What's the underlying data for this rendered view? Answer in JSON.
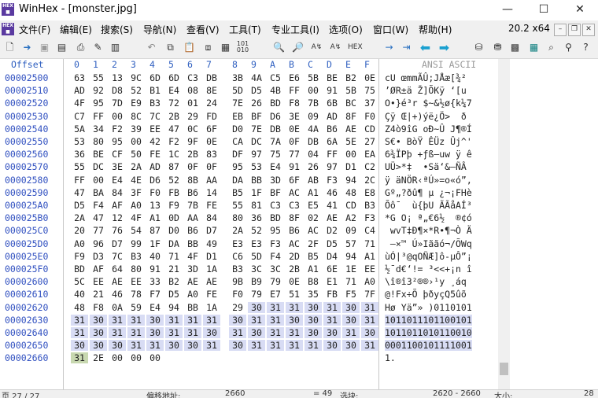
{
  "window": {
    "title": "WinHex - [monster.jpg]",
    "minimize": "—",
    "maximize": "☐",
    "close": "✕"
  },
  "menu": [
    "文件(F)",
    "编辑(E)",
    "搜索(S)",
    "导航(N)",
    "查看(V)",
    "工具(T)",
    "专业工具(I)",
    "选项(O)",
    "窗口(W)",
    "帮助(H)"
  ],
  "version": "20.2 x64",
  "header": {
    "offset_label": "Offset",
    "columns": [
      "0",
      "1",
      "2",
      "3",
      "4",
      "5",
      "6",
      "7",
      "8",
      "9",
      "A",
      "B",
      "C",
      "D",
      "E",
      "F"
    ],
    "ansi_label": "ANSI ASCII"
  },
  "rows": [
    {
      "offset": "00002500",
      "bytes": [
        "63",
        "55",
        "13",
        "9C",
        "6D",
        "6D",
        "C3",
        "DB",
        "3B",
        "4A",
        "C5",
        "E6",
        "5B",
        "BE",
        "B2",
        "0E"
      ],
      "ansi": "cU œmmÃÛ;JÅæ[¾²"
    },
    {
      "offset": "00002510",
      "bytes": [
        "AD",
        "92",
        "D8",
        "52",
        "B1",
        "E4",
        "08",
        "8E",
        "5D",
        "D5",
        "4B",
        "FF",
        "00",
        "91",
        "5B",
        "75"
      ],
      "ansi": "­’ØR±ä Ž]ÕKÿ ‘[u"
    },
    {
      "offset": "00002520",
      "bytes": [
        "4F",
        "95",
        "7D",
        "E9",
        "B3",
        "72",
        "01",
        "24",
        "7E",
        "26",
        "BD",
        "F8",
        "7B",
        "6B",
        "BC",
        "37"
      ],
      "ansi": "O•}é³r $~&½ø{k¼7"
    },
    {
      "offset": "00002530",
      "bytes": [
        "C7",
        "FF",
        "00",
        "8C",
        "7C",
        "2B",
        "29",
        "FD",
        "EB",
        "BF",
        "D6",
        "3E",
        "09",
        "AD",
        "8F",
        "F0"
      ],
      "ansi": "Çÿ Œ|+)ýë¿Ö> ­ ð"
    },
    {
      "offset": "00002540",
      "bytes": [
        "5A",
        "34",
        "F2",
        "39",
        "EE",
        "47",
        "0C",
        "6F",
        "D0",
        "7E",
        "DB",
        "0E",
        "4A",
        "B6",
        "AE",
        "CD"
      ],
      "ansi": "Z4ò9îG oÐ~Û J¶®Í"
    },
    {
      "offset": "00002550",
      "bytes": [
        "53",
        "80",
        "95",
        "00",
        "42",
        "F2",
        "9F",
        "0E",
        "CA",
        "DC",
        "7A",
        "0F",
        "DB",
        "6A",
        "5E",
        "27"
      ],
      "ansi": "S€• BòŸ ÊÜz Ûj^'"
    },
    {
      "offset": "00002560",
      "bytes": [
        "36",
        "BE",
        "CF",
        "50",
        "FE",
        "1C",
        "2B",
        "83",
        "DF",
        "97",
        "75",
        "77",
        "04",
        "FF",
        "00",
        "EA"
      ],
      "ansi": "6¾ÏPþ +ƒß—uw ÿ ê"
    },
    {
      "offset": "00002570",
      "bytes": [
        "55",
        "DC",
        "3E",
        "2A",
        "AD",
        "87",
        "0F",
        "0F",
        "95",
        "53",
        "E4",
        "91",
        "26",
        "97",
        "D1",
        "C2"
      ],
      "ansi": "UÜ>*­‡  •Sä‘&—ÑÂ"
    },
    {
      "offset": "00002580",
      "bytes": [
        "FF",
        "00",
        "E4",
        "4E",
        "D6",
        "52",
        "8B",
        "AA",
        "DA",
        "BB",
        "3D",
        "6F",
        "AB",
        "F3",
        "94",
        "2C"
      ],
      "ansi": "ÿ äNÖR‹ªÚ»=o«ó”,"
    },
    {
      "offset": "00002590",
      "bytes": [
        "47",
        "BA",
        "84",
        "3F",
        "F0",
        "FB",
        "B6",
        "14",
        "B5",
        "1F",
        "BF",
        "AC",
        "A1",
        "46",
        "48",
        "E8"
      ],
      "ansi": "Gº„?ðû¶ µ ¿¬¡FHè"
    },
    {
      "offset": "000025A0",
      "bytes": [
        "D5",
        "F4",
        "AF",
        "A0",
        "13",
        "F9",
        "7B",
        "FE",
        "55",
        "81",
        "C3",
        "C3",
        "E5",
        "41",
        "CD",
        "B3"
      ],
      "ansi": "Õô¯  ù{þU ÃÃåAÍ³"
    },
    {
      "offset": "000025B0",
      "bytes": [
        "2A",
        "47",
        "12",
        "4F",
        "A1",
        "0D",
        "AA",
        "84",
        "80",
        "36",
        "BD",
        "8F",
        "02",
        "AE",
        "A2",
        "F3"
      ],
      "ansi": "*G O¡ ª„€6½  ®¢ó"
    },
    {
      "offset": "000025C0",
      "bytes": [
        "20",
        "77",
        "76",
        "54",
        "87",
        "D0",
        "B6",
        "D7",
        "2A",
        "52",
        "95",
        "B6",
        "AC",
        "D2",
        "09",
        "C4"
      ],
      "ansi": " wvT‡Ð¶×*R•¶¬Ò Ä"
    },
    {
      "offset": "000025D0",
      "bytes": [
        "A0",
        "96",
        "D7",
        "99",
        "1F",
        "DA",
        "BB",
        "49",
        "E3",
        "E3",
        "F3",
        "AC",
        "2F",
        "D5",
        "57",
        "71"
      ],
      "ansi": " –×™ Ú»Iããó¬/ÕWq"
    },
    {
      "offset": "000025E0",
      "bytes": [
        "F9",
        "D3",
        "7C",
        "B3",
        "40",
        "71",
        "4F",
        "D1",
        "C6",
        "5D",
        "F4",
        "2D",
        "B5",
        "D4",
        "94",
        "A1"
      ],
      "ansi": "ùÓ|³@qOÑÆ]ô-µÔ”¡"
    },
    {
      "offset": "000025F0",
      "bytes": [
        "BD",
        "AF",
        "64",
        "80",
        "91",
        "21",
        "3D",
        "1A",
        "B3",
        "3C",
        "3C",
        "2B",
        "A1",
        "6E",
        "1E",
        "EE"
      ],
      "ansi": "½¯d€‘!= ³<<+¡n î"
    },
    {
      "offset": "00002600",
      "bytes": [
        "5C",
        "EE",
        "AE",
        "EE",
        "33",
        "B2",
        "AE",
        "AE",
        "9B",
        "B9",
        "79",
        "0E",
        "B8",
        "E1",
        "71",
        "A0"
      ],
      "ansi": "\\î®î3²®®›¹y ¸áq "
    },
    {
      "offset": "00002610",
      "bytes": [
        "40",
        "21",
        "46",
        "78",
        "F7",
        "D5",
        "A0",
        "FE",
        "F0",
        "79",
        "E7",
        "51",
        "35",
        "FB",
        "F5",
        "7F"
      ],
      "ansi": "@!Fx÷Õ þðyçQ5ûõ"
    },
    {
      "offset": "00002620",
      "bytes": [
        "48",
        "F8",
        "0A",
        "59",
        "E4",
        "94",
        "BB",
        "1A",
        "29",
        "30",
        "31",
        "31",
        "30",
        "31",
        "30",
        "31"
      ],
      "ansi": "Hø Yä”» )0110101"
    },
    {
      "offset": "00002630",
      "bytes": [
        "31",
        "30",
        "31",
        "31",
        "30",
        "31",
        "31",
        "31",
        "30",
        "31",
        "31",
        "30",
        "30",
        "31",
        "30",
        "31"
      ],
      "ansi": "1011011101100101"
    },
    {
      "offset": "00002640",
      "bytes": [
        "31",
        "30",
        "31",
        "31",
        "30",
        "31",
        "31",
        "30",
        "31",
        "30",
        "31",
        "31",
        "30",
        "30",
        "31",
        "30"
      ],
      "ansi": "1011011010110010"
    },
    {
      "offset": "00002650",
      "bytes": [
        "30",
        "30",
        "30",
        "31",
        "31",
        "30",
        "30",
        "31",
        "30",
        "31",
        "31",
        "31",
        "31",
        "30",
        "30",
        "31"
      ],
      "ansi": "0001100101111001"
    },
    {
      "offset": "00002660",
      "bytes": [
        "31",
        "2E",
        "00",
        "00",
        "00",
        "",
        "",
        "",
        "",
        "",
        "",
        "",
        "",
        "",
        "",
        ""
      ],
      "ansi": "1."
    }
  ],
  "status": {
    "page": "页 27 / 27",
    "offset_label": "偏移地址:",
    "offset_value": "2660",
    "value": "= 49",
    "block_label": "选块:",
    "block_value": "2620 - 2660",
    "size_label": "大小:",
    "size_value": "28"
  },
  "toolbar_icons": [
    "new-file-icon",
    "open-file-icon",
    "save-icon",
    "save-all-icon",
    "print-icon",
    "properties-icon",
    "open-disk-icon",
    "undo-icon",
    "copy-icon",
    "paste-icon",
    "cut-icon",
    "copy-block-icon",
    "paste-block-icon",
    "binary-icon",
    "find-text-icon",
    "find-hex-icon",
    "replace-text-icon",
    "replace-hex-icon",
    "goto-offset-icon",
    "goto-sector-icon",
    "back-icon",
    "forward-icon",
    "disk-editor-icon",
    "ram-editor-icon",
    "calculator-icon",
    "hash-icon",
    "search-icon",
    "zoom-icon",
    "help-icon"
  ]
}
